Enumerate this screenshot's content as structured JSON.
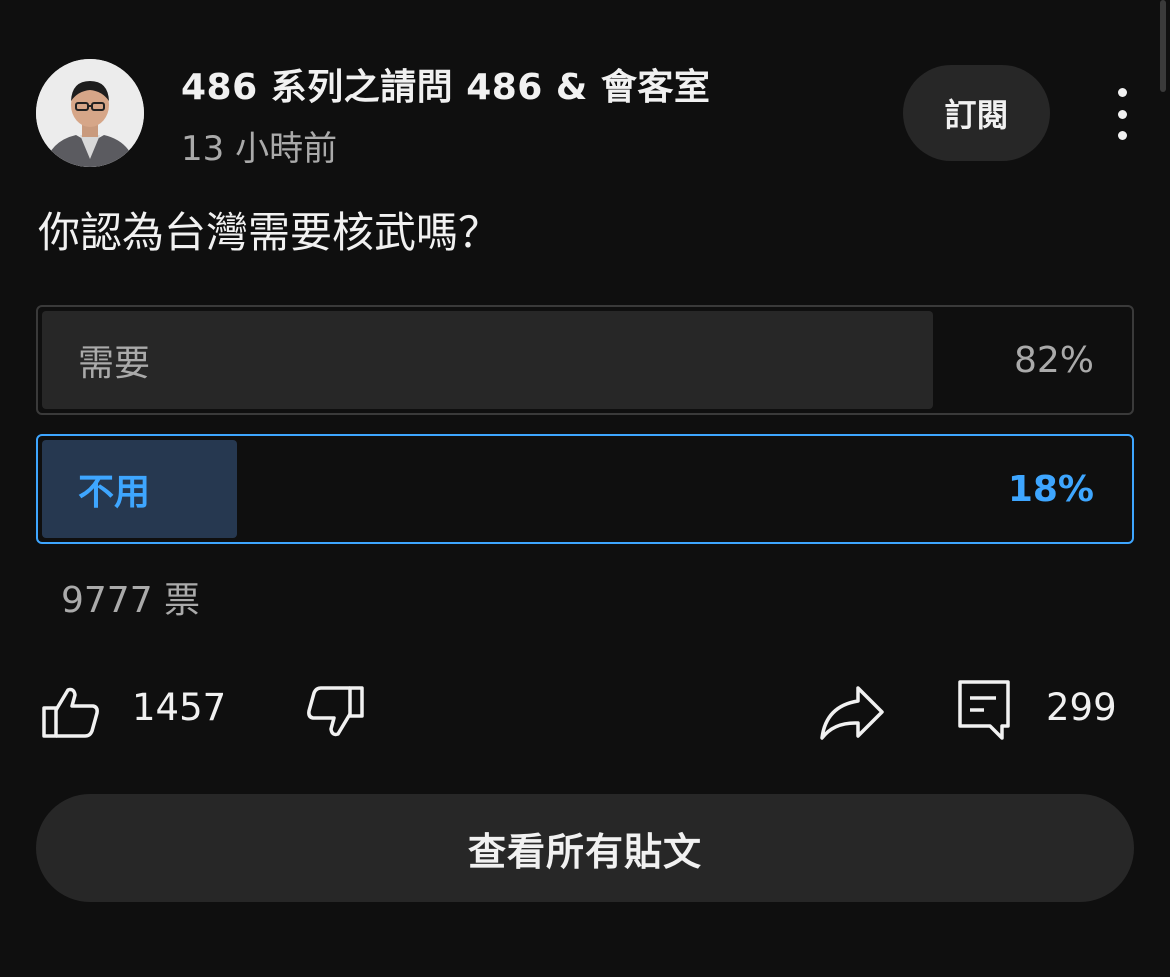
{
  "post": {
    "channel_name": "486 系列之請問 486 & 會客室",
    "time_ago": "13 小時前",
    "subscribe_label": "訂閱",
    "avatar_icon": "person-avatar-icon",
    "more_icon": "more-vert-icon"
  },
  "poll": {
    "question": "你認為台灣需要核武嗎？",
    "options": [
      {
        "label": "需要",
        "percent_text": "82%",
        "percent": 82,
        "selected": false
      },
      {
        "label": "不用",
        "percent_text": "18%",
        "percent": 18,
        "selected": true
      }
    ],
    "votes": "9777 票"
  },
  "actions": {
    "like_count": "1457",
    "comment_count": "299",
    "icons": [
      "thumb-up-icon",
      "thumb-down-icon",
      "share-icon",
      "comment-icon"
    ]
  },
  "footer": {
    "view_all_label": "查看所有貼文"
  },
  "colors": {
    "background": "#0f0f0f",
    "accent": "#3ea6ff",
    "surface": "#272727",
    "selected_fill": "#263850",
    "muted_text": "#aaaaaa"
  }
}
